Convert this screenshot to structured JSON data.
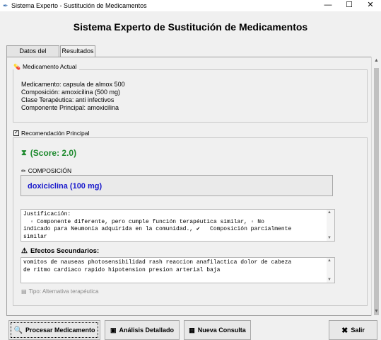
{
  "window": {
    "title": "Sistema Experto - Sustitución de Medicamentos",
    "minimize": "—",
    "maximize": "☐",
    "close": "✕"
  },
  "header": {
    "title": "Sistema Experto de Sustitución de Medicamentos"
  },
  "tabs": [
    {
      "label": "Datos del Paciente"
    },
    {
      "label": "Resultados"
    }
  ],
  "medicamento_actual": {
    "label": "Medicamento Actual",
    "lines": [
      "Medicamento: capsula de almox 500",
      "Composición: amoxicilina (500 mg)",
      "Clase Terapéutica: anti infectivos",
      "Componente Principal: amoxicilina"
    ]
  },
  "recomendacion": {
    "label": "Recomendación Principal",
    "score": "(Score: 2.0)",
    "composicion_label": "COMPOSICIÓN",
    "composicion_value": "doxiciclina (100 mg)",
    "justificacion": "Justificación:\n  ◦ Componente diferente, pero cumple función terapéutica similar, ◦ No\nindicado para Neumonía adquirida en la comunidad., ✔   Composición parcialmente\nsimilar",
    "efectos_title": "Efectos Secundarios:",
    "efectos_text": "vomitos de nauseas photosensibilidad rash reaccion anafilactica dolor de cabeza\nde ritmo cardiaco rapido hipotension presion arterial baja",
    "tipo": "Tipo: Alternativa terapéutica"
  },
  "buttons": {
    "procesar": "Procesar Medicamento",
    "analisis": "Análisis Detallado",
    "nueva": "Nueva Consulta",
    "salir": "Salir"
  }
}
